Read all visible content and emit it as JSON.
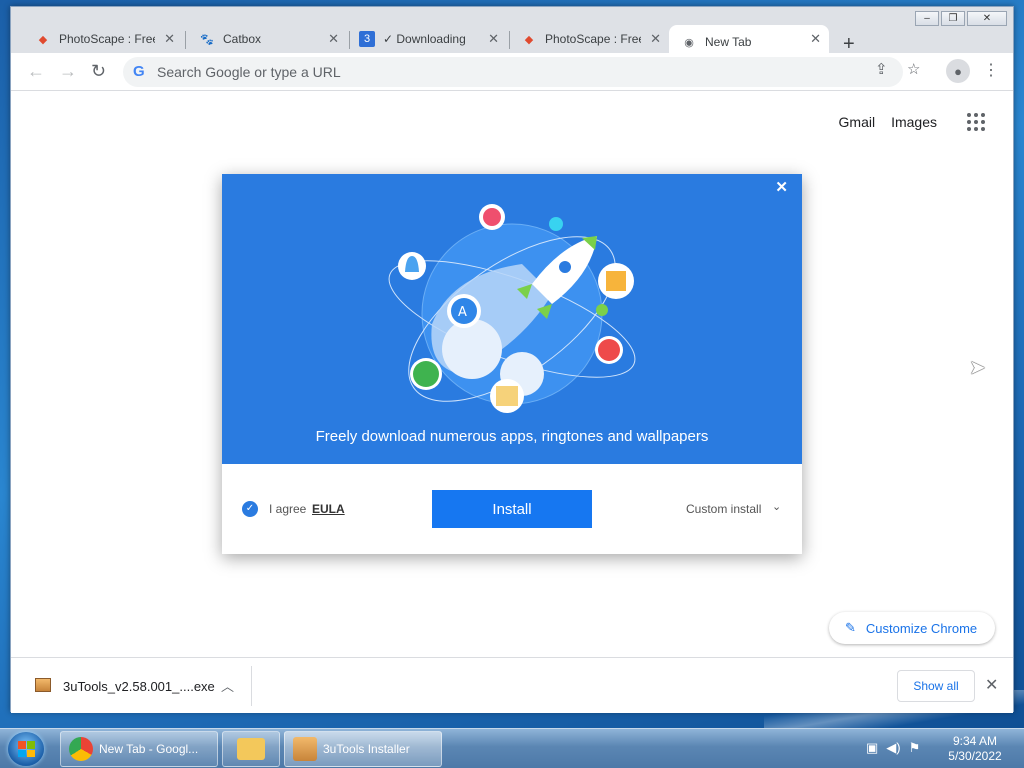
{
  "window": {
    "controls": [
      "minimize",
      "restore",
      "close"
    ]
  },
  "tabs": [
    {
      "title": "PhotoScape : Free",
      "icon": "photoscape-icon",
      "active": false
    },
    {
      "title": "Catbox",
      "icon": "catbox-icon",
      "active": false
    },
    {
      "title": "✓ Downloading",
      "icon": "download-site-icon",
      "active": false
    },
    {
      "title": "PhotoScape : Free",
      "icon": "photoscape-icon",
      "active": false
    },
    {
      "title": "New Tab",
      "icon": "chrome-icon",
      "active": true
    }
  ],
  "toolbar": {
    "omnibox_placeholder": "Search Google or type a URL",
    "google_g": "G"
  },
  "ntp": {
    "gmail": "Gmail",
    "images": "Images",
    "customize": "Customize Chrome"
  },
  "installer": {
    "tagline": "Freely download numerous apps, ringtones and wallpapers",
    "agree": "I agree",
    "eula": "EULA",
    "install": "Install",
    "custom_install": "Custom install",
    "accent": "#2a7be0",
    "button_color": "#1677f1"
  },
  "download_shelf": {
    "file": "3uTools_v2.58.001_....exe",
    "show_all": "Show all"
  },
  "taskbar": {
    "items": [
      {
        "label": "New Tab - Googl...",
        "icon": "chrome-icon"
      },
      {
        "label": "",
        "icon": "folder-icon"
      },
      {
        "label": "3uTools Installer",
        "icon": "3utools-icon"
      }
    ],
    "time": "9:34 AM",
    "date": "5/30/2022"
  }
}
